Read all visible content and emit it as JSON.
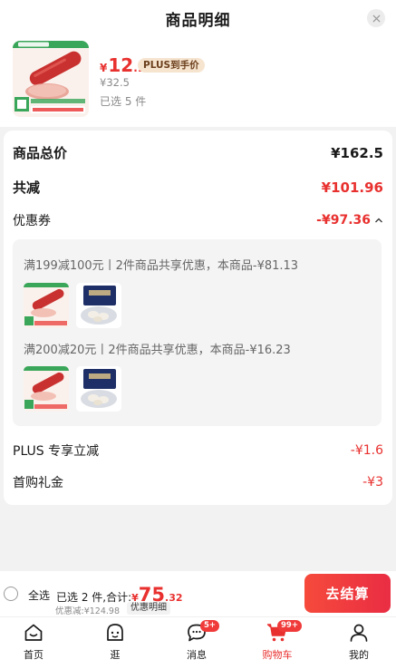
{
  "header": {
    "title": "商品明细"
  },
  "product": {
    "price_currency": "¥",
    "price_integer": "12",
    "price_decimal": ".1",
    "plus_tag": "PLUS到手价",
    "original_price": "¥32.5",
    "selected_count": "已选 5 件",
    "thumb_brand_tag": "好吃不贵",
    "thumb_caption": "现货 下单 鲜城风味"
  },
  "summary": {
    "total_label": "商品总价",
    "total_value": "¥162.5",
    "saved_label": "共减",
    "saved_value": "¥101.96",
    "coupon_label": "优惠券",
    "coupon_value": "-¥97.36",
    "plus_label": "PLUS 专享立减",
    "plus_value": "-¥1.6",
    "first_gift_label": "首购礼金",
    "first_gift_value": "-¥3"
  },
  "coupons": [
    {
      "desc": "满199减100元丨2件商品共享优惠，本商品-¥81.13"
    },
    {
      "desc": "满200减20元丨2件商品共享优惠，本商品-¥16.23"
    }
  ],
  "bottom_bar": {
    "select_all": "全选",
    "selected_summary": "已选 2 件,合计:",
    "total_currency": "¥",
    "total_integer": "75",
    "total_decimal": ".32",
    "discount_note": "优惠减:¥124.98",
    "detail_link": "优惠明细",
    "checkout": "去结算"
  },
  "tabbar": {
    "items": [
      {
        "label": "首页",
        "icon": "home-icon"
      },
      {
        "label": "逛",
        "icon": "face-icon"
      },
      {
        "label": "消息",
        "icon": "message-icon",
        "badge": "5+"
      },
      {
        "label": "购物车",
        "icon": "cart-icon",
        "badge": "99+"
      },
      {
        "label": "我的",
        "icon": "user-icon"
      }
    ]
  },
  "colors": {
    "accent_red": "#e8312f",
    "plus_tag_bg": "#f6e4cf",
    "page_bg": "#f2f2f2"
  }
}
